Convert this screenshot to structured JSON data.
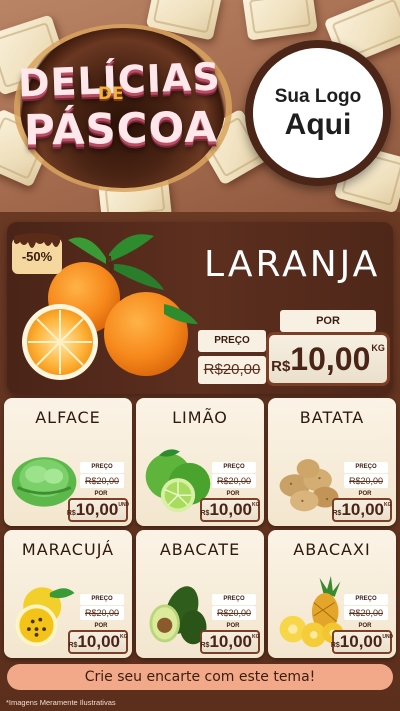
{
  "header": {
    "title_line1": "DELÍCIAS",
    "title_connector": "DE",
    "title_line2": "PÁSCOA",
    "logo_line1": "Sua Logo",
    "logo_line2": "Aqui"
  },
  "featured": {
    "discount": "-50%",
    "name": "LARANJA",
    "label_old": "PREÇO",
    "old_price": "R$20,00",
    "label_new": "POR",
    "currency": "R$",
    "new_price": "10,00",
    "unit": "KG"
  },
  "products": [
    {
      "name": "ALFACE",
      "label_old": "PREÇO",
      "old_price": "R$20,00",
      "label_new": "POR",
      "currency": "R$",
      "new_price": "10,00",
      "unit": "UND"
    },
    {
      "name": "LIMÃO",
      "label_old": "PREÇO",
      "old_price": "R$20,00",
      "label_new": "POR",
      "currency": "R$",
      "new_price": "10,00",
      "unit": "KG"
    },
    {
      "name": "BATATA",
      "label_old": "PREÇO",
      "old_price": "R$20,00",
      "label_new": "POR",
      "currency": "R$",
      "new_price": "10,00",
      "unit": "KG"
    },
    {
      "name": "MARACUJÁ",
      "label_old": "PREÇO",
      "old_price": "R$20,00",
      "label_new": "POR",
      "currency": "R$",
      "new_price": "10,00",
      "unit": "KG"
    },
    {
      "name": "ABACATE",
      "label_old": "PREÇO",
      "old_price": "R$20,00",
      "label_new": "POR",
      "currency": "R$",
      "new_price": "10,00",
      "unit": "KG"
    },
    {
      "name": "ABACAXI",
      "label_old": "PREÇO",
      "old_price": "R$20,00",
      "label_new": "POR",
      "currency": "R$",
      "new_price": "10,00",
      "unit": "UND"
    }
  ],
  "footer": {
    "cta": "Crie seu encarte com este tema!",
    "disclaimer": "*Imagens Meramente Ilustrativas"
  },
  "colors": {
    "brown_dark": "#4a2418",
    "brown_bg": "#5c2f1d",
    "cream": "#f7f0e3",
    "salmon": "#f2a98a"
  }
}
